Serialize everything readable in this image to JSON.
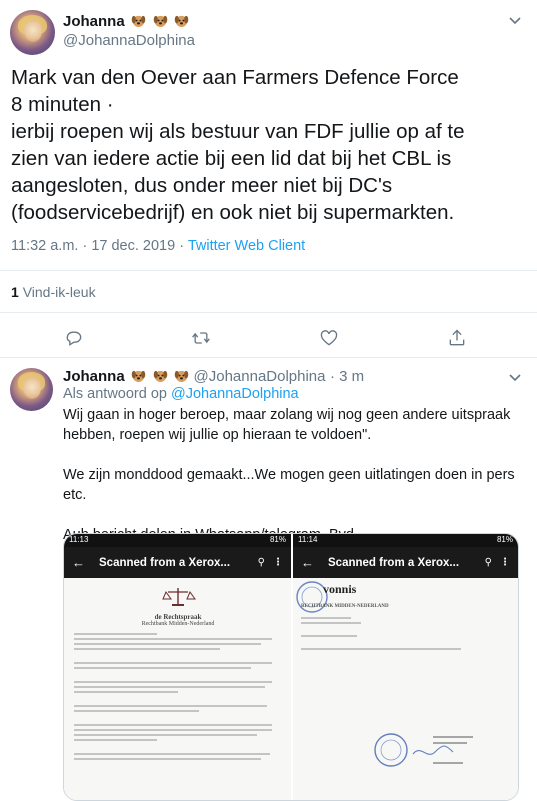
{
  "main_tweet": {
    "author_name": "Johanna",
    "handle": "@JohannaDolphina",
    "text_lines": [
      "Mark van den Oever aan Farmers Defence Force",
      "8 minuten ·",
      "ierbij roepen wij als bestuur van FDF jullie op af te",
      "zien van iedere actie bij een lid dat bij het CBL is",
      "aangesloten, dus onder meer niet bij DC's",
      "(foodservicebedrijf) en ook niet bij supermarkten."
    ],
    "time": "11:32 a.m. · 17 dec. 2019 ·",
    "source": "Twitter Web Client",
    "likes_count": "1",
    "likes_label": "Vind-ik-leuk"
  },
  "reply_tweet": {
    "author_name": "Johanna",
    "handle": "@JohannaDolphina",
    "time_ago": "· 3 m",
    "reply_to_prefix": "Als antwoord op",
    "reply_to_handle": "@JohannaDolphina",
    "body": {
      "p1_line1": "Wij gaan in hoger beroep, maar zolang wij nog geen andere uitspraak",
      "p1_line2": "hebben, roepen wij jullie op hieraan te voldoen\".",
      "p2_line1": "We zijn monddood gemaakt...We mogen geen uitlatingen doen in pers",
      "p2_line2": "etc.",
      "p3": "Aub bericht delen in Whatsapp/telegram. Bvd"
    }
  },
  "media": {
    "left_phone": {
      "time": "11:13",
      "battery": "81%",
      "title": "Scanned from a Xerox...",
      "logo": "de Rechtspraak",
      "court": "Rechtbank Midden-Nederland"
    },
    "right_phone": {
      "time": "11:14",
      "battery": "81%",
      "title": "Scanned from a Xerox...",
      "heading": "vonnis",
      "court": "RECHTBANK MIDDEN-NEDERLAND"
    }
  },
  "icons": [
    "chevron-down-icon",
    "reply-icon",
    "retweet-icon",
    "like-icon",
    "share-icon",
    "back-arrow-icon",
    "search-icon",
    "more-icon"
  ],
  "colors": {
    "link": "#1da1f2",
    "muted": "#657786",
    "text": "#14171a",
    "border": "#e6ecf0"
  }
}
